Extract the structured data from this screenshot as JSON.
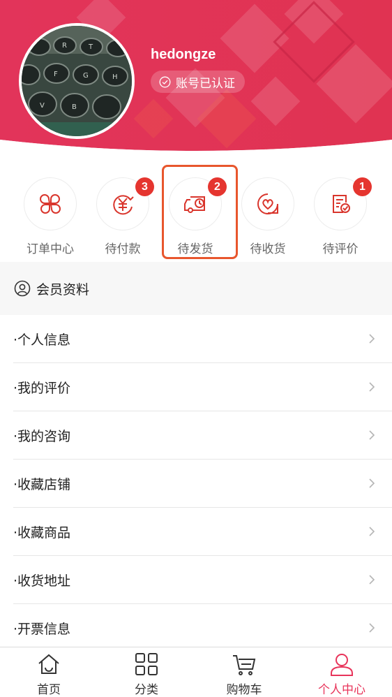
{
  "profile": {
    "username": "hedongze",
    "verified_label": "账号已认证"
  },
  "orders": [
    {
      "label": "订单中心",
      "icon": "order-center-icon",
      "badge": null
    },
    {
      "label": "待付款",
      "icon": "pending-payment-icon",
      "badge": "3"
    },
    {
      "label": "待发货",
      "icon": "pending-shipment-icon",
      "badge": "2"
    },
    {
      "label": "待收货",
      "icon": "pending-receipt-icon",
      "badge": null
    },
    {
      "label": "待评价",
      "icon": "pending-review-icon",
      "badge": "1"
    }
  ],
  "member_section": {
    "title": "会员资料",
    "icon": "user-circle-icon"
  },
  "menu": [
    {
      "label": "·个人信息"
    },
    {
      "label": "·我的评价"
    },
    {
      "label": "·我的咨询"
    },
    {
      "label": "·收藏店铺"
    },
    {
      "label": "·收藏商品"
    },
    {
      "label": "·收货地址"
    },
    {
      "label": "·开票信息"
    }
  ],
  "tabbar": [
    {
      "label": "首页",
      "icon": "home-icon"
    },
    {
      "label": "分类",
      "icon": "category-grid-icon"
    },
    {
      "label": "购物车",
      "icon": "cart-icon"
    },
    {
      "label": "个人中心",
      "icon": "user-icon",
      "active": true
    }
  ],
  "colors": {
    "brand": "#e23a5a",
    "accent_badge": "#e5352f",
    "active_tab": "#e8345a",
    "highlight_box": "#e8562d"
  }
}
